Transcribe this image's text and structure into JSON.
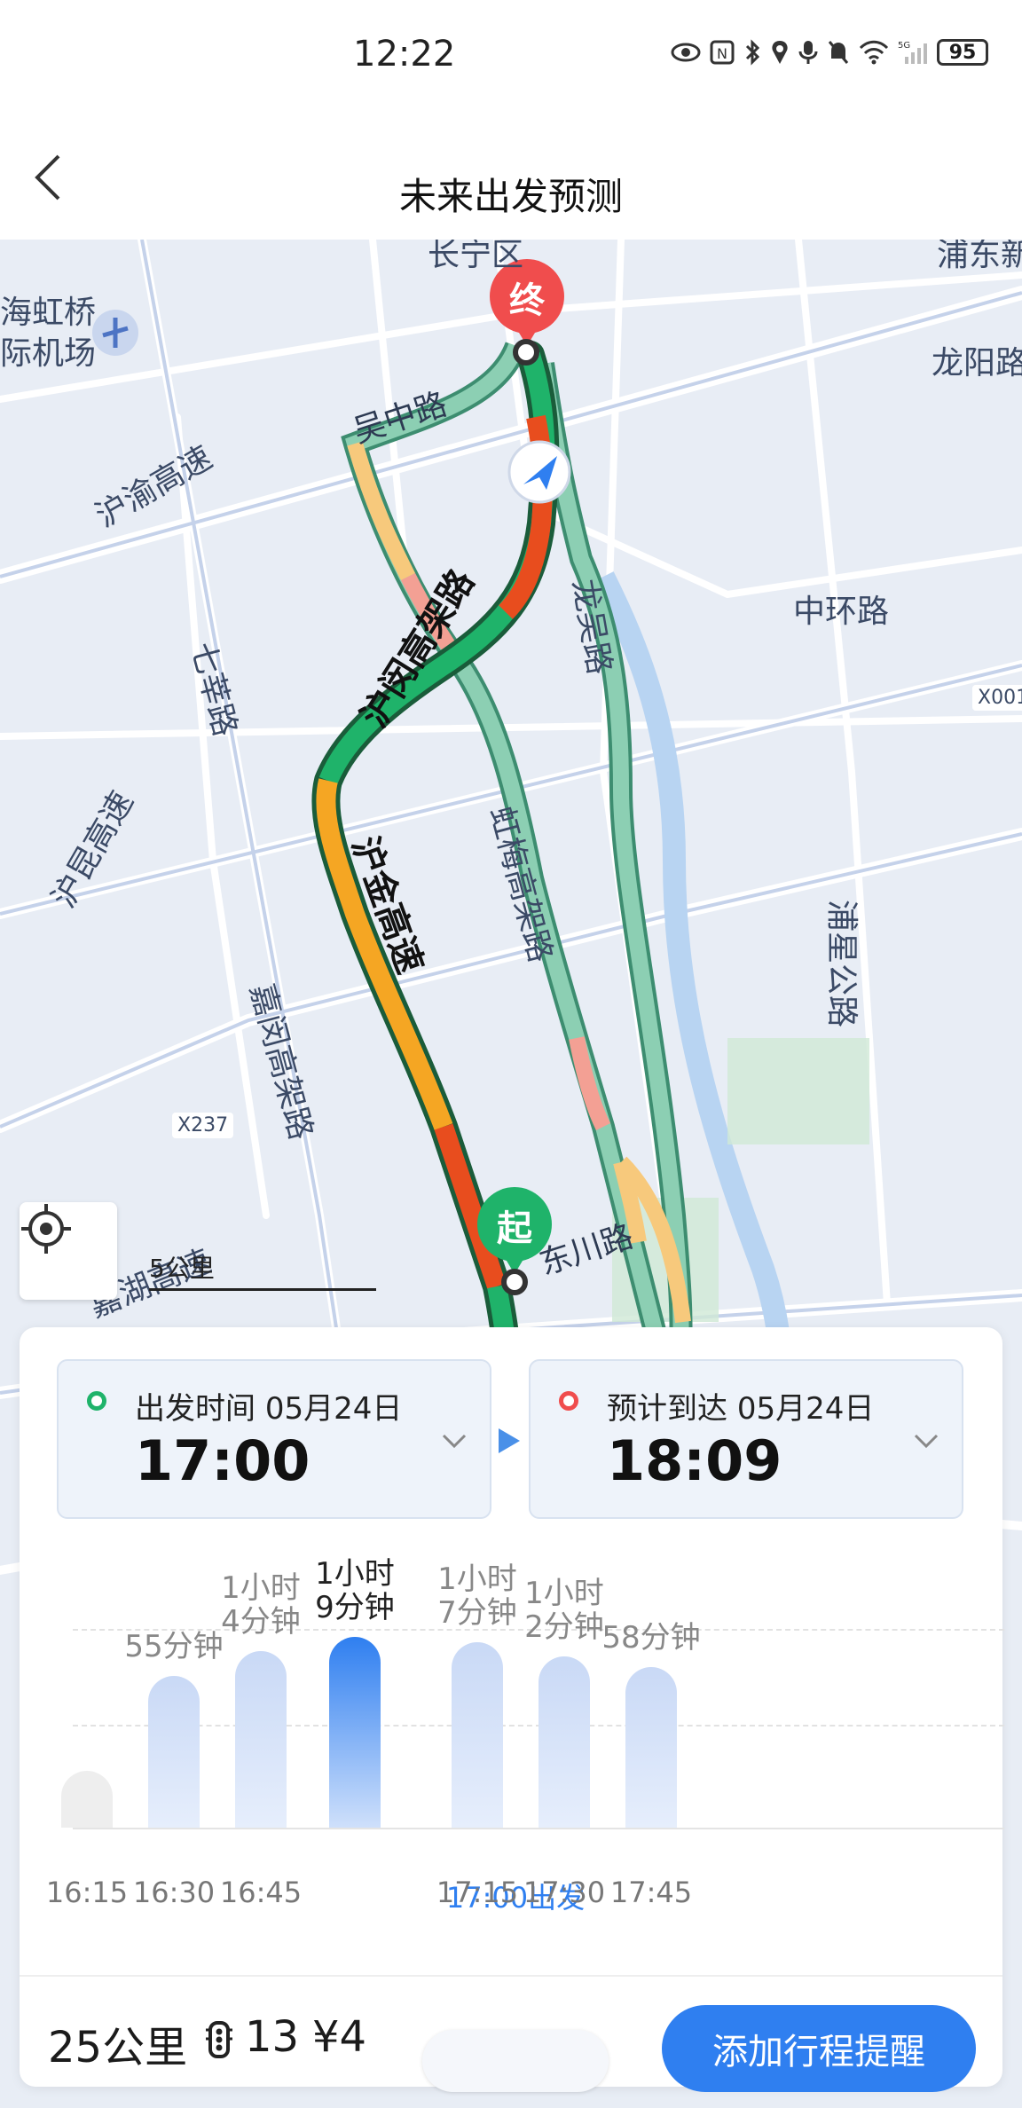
{
  "status_bar": {
    "time": "12:22",
    "battery": "95",
    "network": "5G"
  },
  "header": {
    "title": "未来出发预测"
  },
  "map": {
    "labels": {
      "airport": "海虹桥\n际机场",
      "huyu": "沪渝高速",
      "wuzhong": "吴中路",
      "longyang": "龙阳路",
      "humin": "沪闵高架路",
      "zhonghuan": "中环路",
      "longwu": "龙吴路",
      "qixin": "七莘路",
      "hongmei": "虹梅高架路",
      "hukun": "沪昆高速",
      "hujin": "沪金高速",
      "jiamin": "嘉闵高架路",
      "puxing": "浦星公路",
      "dongchuan": "东川路",
      "x237": "X237",
      "x001": "X001",
      "changning": "长宁区",
      "pudong": "浦东新",
      "jiahu": "嘉湖高速"
    },
    "start_marker": "起",
    "end_marker": "终",
    "scale_label": "5公里"
  },
  "depart": {
    "label": "出发时间",
    "date": "05月24日",
    "time": "17:00"
  },
  "arrive": {
    "label": "预计到达",
    "date": "05月24日",
    "time": "18:09"
  },
  "forecast": [
    {
      "time": "16:15",
      "duration": "",
      "minutes": 0,
      "state": "past"
    },
    {
      "time": "16:30",
      "duration": "55分钟",
      "minutes": 55,
      "state": "normal"
    },
    {
      "time": "16:45",
      "duration": "1小时\n4分钟",
      "minutes": 64,
      "state": "normal"
    },
    {
      "time": "17:00出发",
      "duration": "1小时\n9分钟",
      "minutes": 69,
      "state": "active"
    },
    {
      "time": "17:15",
      "duration": "1小时\n7分钟",
      "minutes": 67,
      "state": "normal"
    },
    {
      "time": "17:30",
      "duration": "1小时\n2分钟",
      "minutes": 62,
      "state": "normal"
    },
    {
      "time": "17:45",
      "duration": "58分钟",
      "minutes": 58,
      "state": "normal"
    }
  ],
  "summary": {
    "distance": "25公里",
    "traffic_lights": "13",
    "fee": "¥4",
    "button": "添加行程提醒"
  },
  "colors": {
    "accent": "#2f7ff0",
    "start_green": "#1fb36a",
    "end_red": "#f04d4d"
  }
}
